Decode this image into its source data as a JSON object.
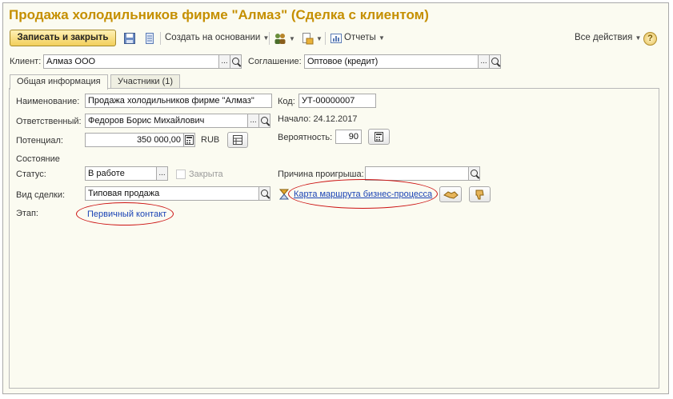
{
  "window": {
    "title": "Продажа холодильников фирме \"Алмаз\" (Сделка с клиентом)"
  },
  "toolbar": {
    "save_close_label": "Записать и закрыть",
    "create_based_label": "Создать на основании",
    "reports_label": "Отчеты",
    "all_actions_label": "Все действия",
    "help_label": "?"
  },
  "header": {
    "client_label": "Клиент:",
    "client_value": "Алмаз ООО",
    "agreement_label": "Соглашение:",
    "agreement_value": "Оптовое (кредит)"
  },
  "tabs": [
    {
      "label": "Общая информация",
      "active": true
    },
    {
      "label": "Участники (1)",
      "active": false
    }
  ],
  "form": {
    "name_label": "Наименование:",
    "name_value": "Продажа холодильников фирме \"Алмаз\"",
    "code_label": "Код:",
    "code_value": "УТ-00000007",
    "responsible_label": "Ответственный:",
    "responsible_value": "Федоров Борис Михайлович",
    "start_text": "Начало: 24.12.2017",
    "potential_label": "Потенциал:",
    "potential_value": "350 000,00",
    "currency": "RUB",
    "probability_label": "Вероятность:",
    "probability_value": "90",
    "state_section": "Состояние",
    "status_label": "Статус:",
    "status_value": "В работе",
    "closed_label": "Закрыта",
    "loss_reason_label": "Причина проигрыша:",
    "loss_reason_value": "",
    "deal_type_label": "Вид сделки:",
    "deal_type_value": "Типовая продажа",
    "process_map_link": "Карта маршрута бизнес-процесса",
    "stage_label": "Этап:",
    "stage_value": "Первичный контакт"
  },
  "colors": {
    "title": "#c58f00",
    "link": "#1a43b5",
    "highlight_ellipse": "#cc1111",
    "background": "#fbfbf1"
  }
}
